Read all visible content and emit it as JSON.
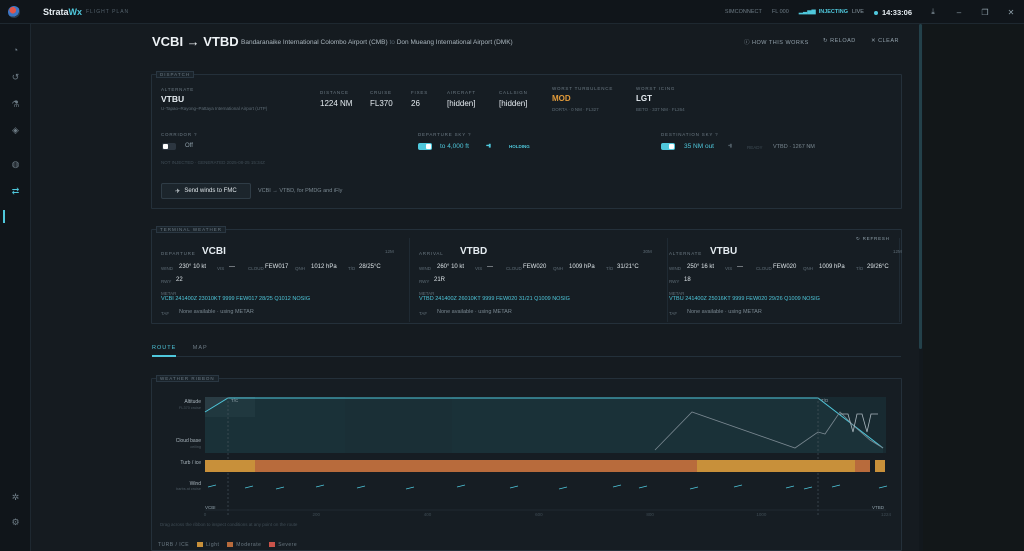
{
  "app": {
    "brand_a": "Strata",
    "brand_b": "Wx",
    "subtitle": "FLIGHT PLAN"
  },
  "topbar": {
    "sim": "SIMCONNECT",
    "fl": "FL 000",
    "injecting": "INJECTING",
    "live": "LIVE",
    "clock": "14:33:06"
  },
  "header": {
    "title": "VCBI → VTBD",
    "dep_name": "Bandaranaike International Colombo Airport (CMB)",
    "to_word": "to",
    "arr_name": "Don Mueang International Airport (DMK)",
    "how": "HOW THIS WORKS",
    "reload": "RELOAD",
    "clear": "CLEAR"
  },
  "dispatch": {
    "tag": "DISPATCH",
    "alternate_label": "ALTERNATE",
    "alternate": "VTBU",
    "alternate_name": "U-Tapao–Rayong–Pattaya International Airport (UTP)",
    "distance_label": "DISTANCE",
    "distance": "1224 NM",
    "cruise_label": "CRUISE",
    "cruise": "FL370",
    "fixes_label": "FIXES",
    "fixes": "26",
    "aircraft_label": "AIRCRAFT",
    "aircraft": "[hidden]",
    "callsign_label": "CALLSIGN",
    "callsign": "[hidden]",
    "turb_label": "WORST TURBULENCE",
    "turb": "MOD",
    "turb_sub": "DORTA · 0 NM · FL327",
    "icing_label": "WORST ICING",
    "icing": "LGT",
    "icing_sub": "BETO · 337 NM · FL264",
    "corridor_label": "CORRIDOR",
    "corridor_state": "Off",
    "generated": "NOT INJECTED · GENERATED 2025-08-25 15:34Z",
    "dep_sky_label": "DEPARTURE SKY",
    "dep_sky": "to 4,000 ft",
    "holding": "HOLDING",
    "dest_sky_label": "DESTINATION SKY",
    "dest_sky": "35 NM out",
    "dest_ready": "READY",
    "dest_tail": "VTBD · 1267 NM",
    "send_btn": "Send winds to FMC",
    "send_note": "VCBI → VTBD, for PMDG and iFly"
  },
  "terminal": {
    "tag": "TERMINAL WEATHER",
    "refresh": "REFRESH",
    "k_wind": "WIND",
    "k_vis": "VIS",
    "k_cloud": "CLOUD",
    "k_qnh": "QNH",
    "k_tempdew": "T/D",
    "k_rwy": "RWY",
    "metar_label": "METAR",
    "taf_label": "TAF",
    "cols": [
      {
        "role": "DEPARTURE",
        "icao": "VCBI",
        "age": "12M",
        "wind": "230° 10 kt",
        "vis": "—",
        "cloud": "FEW017",
        "qnh": "1012 hPa",
        "td": "28/25°C",
        "rwy": "22",
        "metar": "VCBI 241400Z 23010KT 9999 FEW017 28/25 Q1012 NOSIG",
        "taf": "None available · using METAR"
      },
      {
        "role": "ARRIVAL",
        "icao": "VTBD",
        "age": "30M",
        "wind": "260° 10 kt",
        "vis": "—",
        "cloud": "FEW020",
        "qnh": "1009 hPa",
        "td": "31/21°C",
        "rwy": "21R",
        "metar": "VTBD 241400Z 26010KT 9999 FEW020 31/21 Q1009 NOSIG",
        "taf": "None available · using METAR"
      },
      {
        "role": "ALTERNATE",
        "icao": "VTBU",
        "age": "12M",
        "wind": "250° 16 kt",
        "vis": "—",
        "cloud": "FEW020",
        "qnh": "1009 hPa",
        "td": "29/26°C",
        "rwy": "18",
        "metar": "VTBU 241400Z 25016KT 9999 FEW020 29/26 Q1009 NOSIG",
        "taf": "None available · using METAR"
      }
    ]
  },
  "tabs": {
    "route": "ROUTE",
    "map": "MAP"
  },
  "ribbon": {
    "tag": "WEATHER RIBBON",
    "altitude": "Altitude",
    "altitude_sub": "FL370 cruise",
    "cloud": "Cloud base",
    "cloud_sub": "ceiling",
    "turb": "Turb / ice",
    "wind": "Wind",
    "wind_sub": "barbs at cruise",
    "toc": "T/C",
    "tod": "T/D",
    "start_icao": "VCBI",
    "end_icao": "VTBD",
    "hint": "Drag across the ribbon to inspect conditions at any point on the route",
    "legend_title": "TURB / ICE",
    "legend_light": "Light",
    "legend_moderate": "Moderate",
    "legend_severe": "Severe",
    "ticks": [
      "0",
      "200",
      "400",
      "600",
      "800",
      "1000",
      "1224"
    ]
  },
  "colors": {
    "accent": "#4fc8dc",
    "moderate": "#e39b3a",
    "light": "#c8903a",
    "severe": "#c9534a"
  }
}
